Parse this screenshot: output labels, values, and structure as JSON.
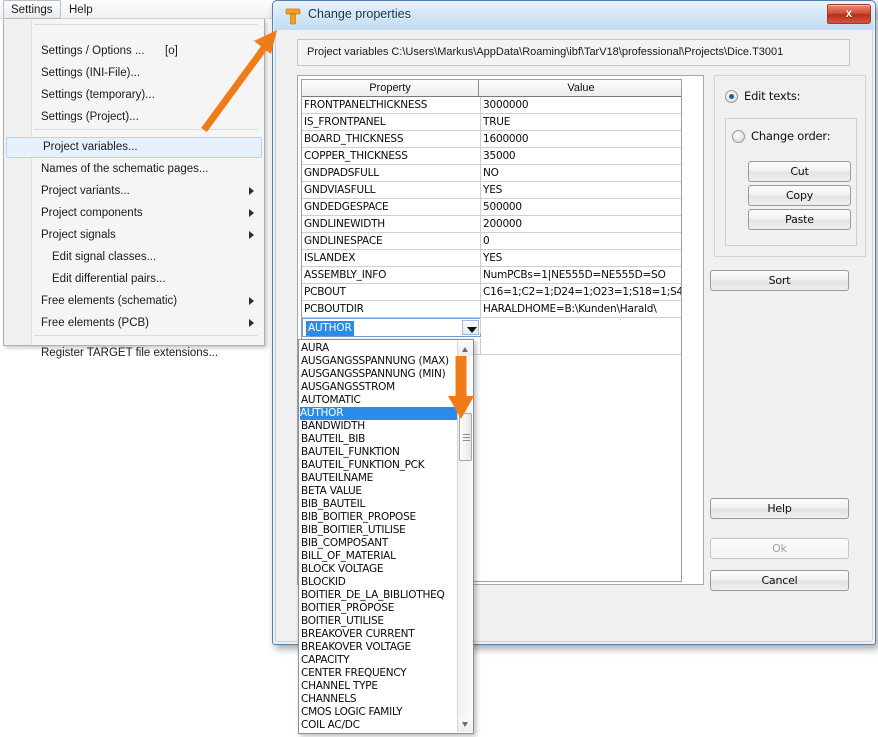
{
  "menubar": {
    "items": [
      {
        "label": "Settings",
        "active": true
      },
      {
        "label": "Help",
        "active": false
      }
    ]
  },
  "menu": {
    "items": [
      {
        "label": "Settings / Options ...",
        "accel": "[o]",
        "arrow": false,
        "indent": false,
        "highlight": false
      },
      {
        "label": "Settings (INI-File)...",
        "accel": "",
        "arrow": false,
        "indent": false,
        "highlight": false
      },
      {
        "label": "Settings (temporary)...",
        "accel": "",
        "arrow": false,
        "indent": false,
        "highlight": false
      },
      {
        "label": "Settings (Project)...",
        "accel": "",
        "arrow": false,
        "indent": false,
        "highlight": false
      },
      {
        "label": "Project variables...",
        "accel": "",
        "arrow": false,
        "indent": false,
        "highlight": true
      },
      {
        "label": "Names of the schematic pages...",
        "accel": "",
        "arrow": false,
        "indent": false,
        "highlight": false
      },
      {
        "label": "Project variants...",
        "accel": "",
        "arrow": true,
        "indent": false,
        "highlight": false
      },
      {
        "label": "Project components",
        "accel": "",
        "arrow": true,
        "indent": false,
        "highlight": false
      },
      {
        "label": "Project signals",
        "accel": "",
        "arrow": true,
        "indent": false,
        "highlight": false
      },
      {
        "label": "Edit signal classes...",
        "accel": "",
        "arrow": false,
        "indent": true,
        "highlight": false
      },
      {
        "label": "Edit differential pairs...",
        "accel": "",
        "arrow": false,
        "indent": true,
        "highlight": false
      },
      {
        "label": "Free elements (schematic)",
        "accel": "",
        "arrow": true,
        "indent": false,
        "highlight": false
      },
      {
        "label": "Free elements (PCB)",
        "accel": "",
        "arrow": true,
        "indent": false,
        "highlight": false
      },
      {
        "label": "Register TARGET file extensions...",
        "accel": "",
        "arrow": false,
        "indent": false,
        "highlight": false
      }
    ]
  },
  "dialog": {
    "title": "Change properties",
    "icon": "target-t-logo-icon",
    "close_label": "x",
    "path": "Project variables C:\\Users\\Markus\\AppData\\Roaming\\ibf\\TarV18\\professional\\Projects\\Dice.T3001",
    "table": {
      "columns": [
        "Property",
        "Value"
      ],
      "rows": [
        {
          "property": "FRONTPANELTHICKNESS",
          "value": "3000000"
        },
        {
          "property": "IS_FRONTPANEL",
          "value": "TRUE"
        },
        {
          "property": "BOARD_THICKNESS",
          "value": "1600000"
        },
        {
          "property": "COPPER_THICKNESS",
          "value": "35000"
        },
        {
          "property": "GNDPADSFULL",
          "value": "NO"
        },
        {
          "property": "GNDVIASFULL",
          "value": "YES"
        },
        {
          "property": "GNDEDGESPACE",
          "value": "500000"
        },
        {
          "property": "GNDLINEWIDTH",
          "value": "200000"
        },
        {
          "property": "GNDLINESPACE",
          "value": "0"
        },
        {
          "property": "ISLANDEX",
          "value": "YES"
        },
        {
          "property": "ASSEMBLY_INFO",
          "value": "NumPCBs=1|NE555D=NE555D=SO"
        },
        {
          "property": "PCBOUT",
          "value": "C16=1;C2=1;D24=1;O23=1;S18=1;S4"
        },
        {
          "property": "PCBOUTDIR",
          "value": "HARALDHOME=B:\\Kunden\\Harald\\"
        }
      ],
      "editing_row": {
        "value": "AUTHOR"
      },
      "empty_row": {
        "property": "",
        "value": ""
      }
    },
    "dropdown": {
      "selected": "AUTHOR",
      "options": [
        "AURA",
        "AUSGANGSSPANNUNG (MAX)",
        "AUSGANGSSPANNUNG (MIN)",
        "AUSGANGSSTROM",
        "AUTOMATIC",
        "AUTHOR",
        "BANDWIDTH",
        "BAUTEIL_BIB",
        "BAUTEIL_FUNKTION",
        "BAUTEIL_FUNKTION_PCK",
        "BAUTEILNAME",
        "BETA VALUE",
        "BIB_BAUTEIL",
        "BIB_BOITIER_PROPOSE",
        "BIB_BOITIER_UTILISE",
        "BIB_COMPOSANT",
        "BILL_OF_MATERIAL",
        "BLOCK VOLTAGE",
        "BLOCKID",
        "BOITIER_DE_LA_BIBLIOTHEQ",
        "BOITIER_PROPOSE",
        "BOITIER_UTILISE",
        "BREAKOVER CURRENT",
        "BREAKOVER VOLTAGE",
        "CAPACITY",
        "CENTER FREQUENCY",
        "CHANNEL TYPE",
        "CHANNELS",
        "CMOS LOGIC FAMILY",
        "COIL AC/DC"
      ]
    },
    "options_panel": {
      "edit_texts_label": "Edit texts:",
      "edit_texts_selected": true,
      "change_order_label": "Change order:",
      "change_order_selected": false,
      "cut_label": "Cut",
      "copy_label": "Copy",
      "paste_label": "Paste"
    },
    "buttons": {
      "sort_label": "Sort",
      "help_label": "Help",
      "ok_label": "Ok",
      "ok_disabled": true,
      "cancel_label": "Cancel"
    }
  },
  "colors": {
    "accent_selection": "#2a8ce8",
    "annotation_arrow": "#f07c19",
    "title_gradient_top": "#e8f2fc",
    "title_gradient_bottom": "#c4dcf3",
    "close_button": "#cf4a33"
  }
}
